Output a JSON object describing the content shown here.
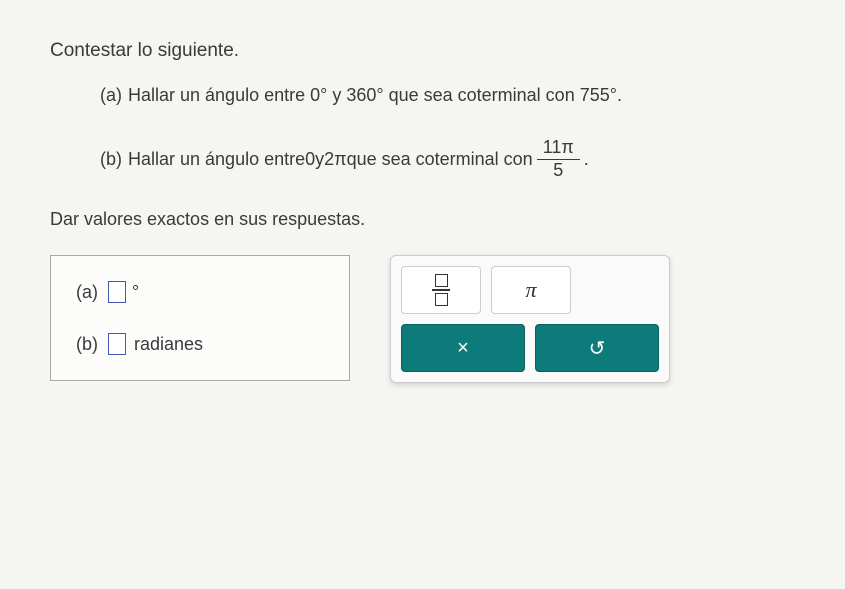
{
  "instruction": "Contestar lo siguiente.",
  "questions": {
    "a": {
      "label": "(a)",
      "text_pre": "Hallar un ángulo entre ",
      "angle1": "0°",
      "text_mid1": " y ",
      "angle2": "360°",
      "text_mid2": " que sea coterminal con ",
      "angle3": "755°",
      "text_post": "."
    },
    "b": {
      "label": "(b)",
      "text_pre": "Hallar un ángulo entre ",
      "angle1": "0",
      "text_mid1": " y ",
      "angle2": "2π",
      "text_mid2": " que sea coterminal con ",
      "frac_num": "11π",
      "frac_den": "5",
      "text_post": "."
    }
  },
  "sub_instruction": "Dar valores exactos en sus respuestas.",
  "answers": {
    "a": {
      "label": "(a)",
      "unit": "°"
    },
    "b": {
      "label": "(b)",
      "unit": "radianes"
    }
  },
  "keypad": {
    "pi": "π",
    "clear": "×",
    "reset": "↺"
  }
}
